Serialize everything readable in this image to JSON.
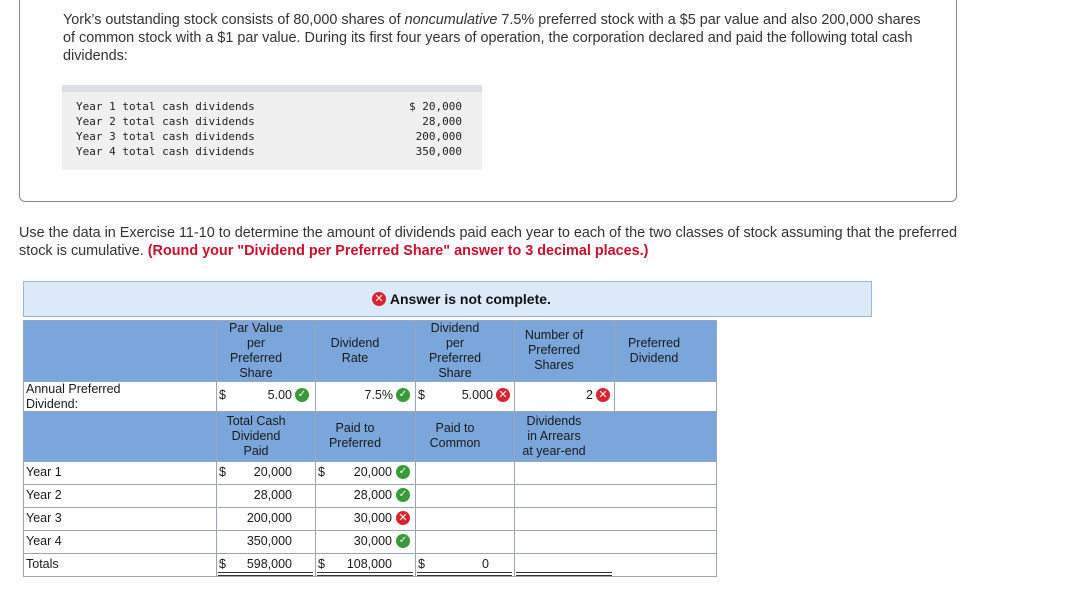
{
  "intro": {
    "part1": "York’s outstanding stock consists of 80,000 shares of ",
    "italic": "noncumulative",
    "part2": " 7.5% preferred stock with a $5 par value and also 200,000 shares of common stock with a $1 par value. During its first four years of operation, the corporation declared and paid the following total cash dividends:"
  },
  "dividend_table": [
    {
      "label": "Year 1 total cash dividends",
      "value": "$ 20,000"
    },
    {
      "label": "Year 2 total cash dividends",
      "value": "28,000"
    },
    {
      "label": "Year 3 total cash dividends",
      "value": "200,000"
    },
    {
      "label": "Year 4 total cash dividends",
      "value": "350,000"
    }
  ],
  "instructions": {
    "text": "Use the data in Exercise 11-10 to determine the amount of dividends paid each year to each of the two classes of stock assuming that the preferred stock is cumulative. ",
    "round_note": "(Round your \"Dividend per Preferred Share\" answer to 3 decimal places.)"
  },
  "banner": {
    "message": "Answer is not complete."
  },
  "header1": {
    "par_value": [
      "Par Value",
      "per",
      "Preferred",
      "Share"
    ],
    "dividend_rate": [
      "Dividend",
      "Rate"
    ],
    "div_per_pref": [
      "Dividend",
      "per",
      "Preferred",
      "Share"
    ],
    "num_pref": [
      "Number of",
      "Preferred",
      "Shares"
    ],
    "pref_dividend": [
      "Preferred",
      "Dividend"
    ]
  },
  "annual_row": {
    "label": [
      "Annual Preferred",
      "Dividend:"
    ],
    "par_currency": "$",
    "par_value": "5.00",
    "rate": "7.5%",
    "div_currency": "$",
    "div_per_share": "5.000",
    "num_shares": "2",
    "pref_dividend": ""
  },
  "header2": {
    "total_cash": [
      "Total Cash",
      "Dividend",
      "Paid"
    ],
    "paid_pref": [
      "Paid to",
      "Preferred"
    ],
    "paid_common": [
      "Paid to",
      "Common"
    ],
    "arrears": [
      "Dividends",
      "in Arrears",
      "at year-end"
    ]
  },
  "rows": [
    {
      "label": "Year 1",
      "cur1": "$",
      "total": "20,000",
      "cur2": "$",
      "pref": "20,000",
      "status": "correct",
      "cur3": "",
      "common": "",
      "arrears": ""
    },
    {
      "label": "Year 2",
      "cur1": "",
      "total": "28,000",
      "cur2": "",
      "pref": "28,000",
      "status": "correct",
      "cur3": "",
      "common": "",
      "arrears": ""
    },
    {
      "label": "Year 3",
      "cur1": "",
      "total": "200,000",
      "cur2": "",
      "pref": "30,000",
      "status": "incorrect",
      "cur3": "",
      "common": "",
      "arrears": ""
    },
    {
      "label": "Year 4",
      "cur1": "",
      "total": "350,000",
      "cur2": "",
      "pref": "30,000",
      "status": "correct",
      "cur3": "",
      "common": "",
      "arrears": ""
    },
    {
      "label": "Totals",
      "cur1": "$",
      "total": "598,000",
      "cur2": "$",
      "pref": "108,000",
      "status": "",
      "cur3": "$",
      "common": "0",
      "arrears": ""
    }
  ],
  "colors": {
    "header_blue": "#7ba6dc",
    "banner_blue": "#dce9f8",
    "error_red": "#d8242f",
    "correct_green": "#3a9a3a",
    "note_red": "#c8102e"
  }
}
